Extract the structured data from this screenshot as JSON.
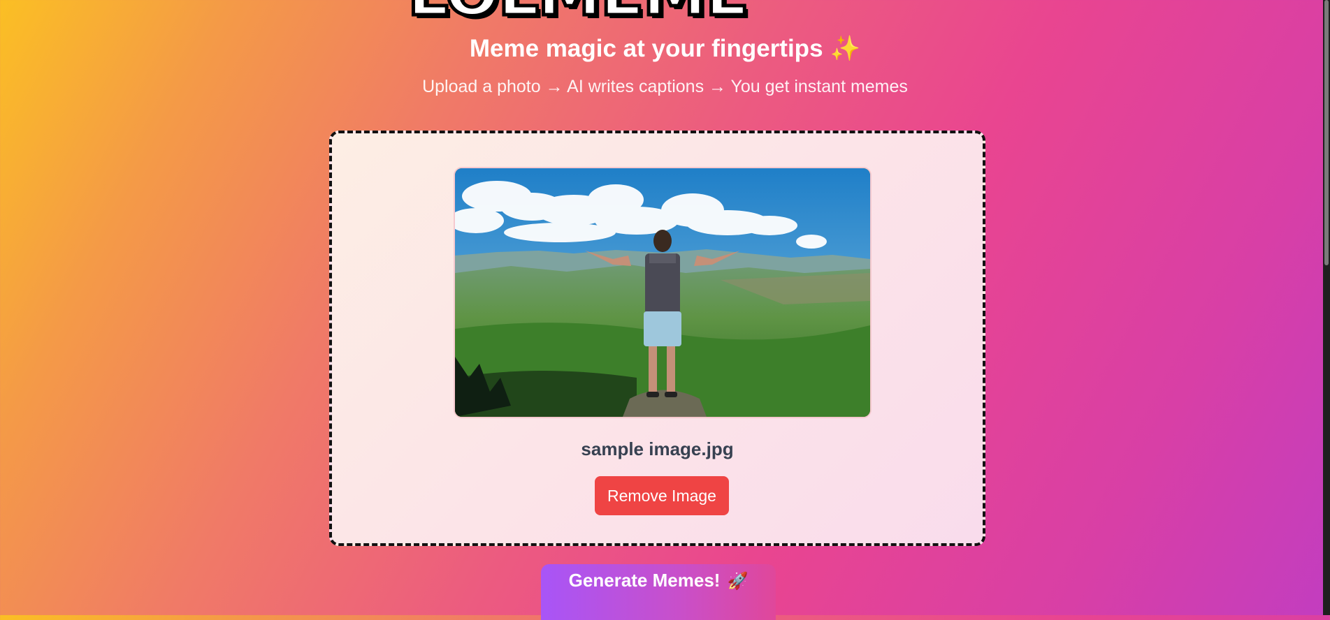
{
  "header": {
    "logo_text": "LOLMEME",
    "tagline": "Meme magic at your fingertips",
    "tagline_emoji": "✨",
    "subtitle": "Upload a photo → AI writes captions → You get instant memes"
  },
  "upload": {
    "file_name": "sample image.jpg",
    "remove_label": "Remove Image"
  },
  "actions": {
    "generate_label": "Generate Memes!",
    "generate_emoji": "🚀"
  },
  "colors": {
    "remove_button": "#ef4444",
    "generate_start": "#a855f7",
    "generate_end": "#e0479a"
  }
}
